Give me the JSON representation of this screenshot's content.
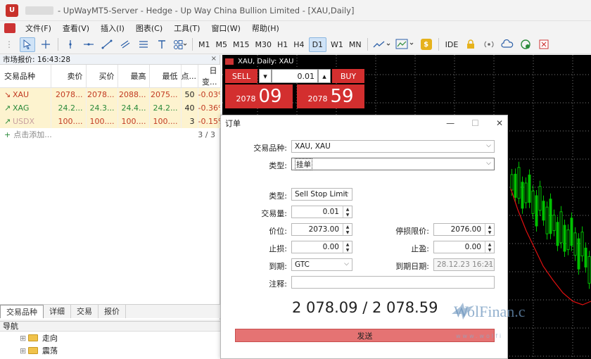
{
  "window": {
    "title": "- UpWayMT5-Server - Hedge - Up Way China Bullion Limited - [XAU,Daily]"
  },
  "menu": [
    "文件(F)",
    "查看(V)",
    "插入(I)",
    "图表(C)",
    "工具(T)",
    "窗口(W)",
    "帮助(H)"
  ],
  "toolbar": {
    "timeframes": [
      "M1",
      "M5",
      "M15",
      "M30",
      "H1",
      "H4",
      "D1",
      "W1",
      "MN"
    ],
    "active_timeframe": "D1",
    "ide_label": "IDE"
  },
  "market_watch": {
    "title": "市场报价: 16:43:28",
    "columns": [
      "交易品种",
      "卖价",
      "买价",
      "最高",
      "最低",
      "点...",
      "日变..."
    ],
    "rows": [
      {
        "symbol": "XAU",
        "arrow": "↘",
        "bid": "2078...",
        "ask": "2078...",
        "high": "2088...",
        "low": "2075...",
        "spread": "50",
        "change": "-0.03%"
      },
      {
        "symbol": "XAG",
        "arrow": "↗",
        "bid": "24.2...",
        "ask": "24.3...",
        "high": "24.4...",
        "low": "24.2...",
        "spread": "40",
        "change": "-0.36%"
      },
      {
        "symbol": "USDX",
        "arrow": "↗",
        "bid": "100....",
        "ask": "100....",
        "high": "100....",
        "low": "100....",
        "spread": "3",
        "change": "-0.15%"
      }
    ],
    "add_label": "点击添加...",
    "count": "3 / 3",
    "tabs": [
      "交易品种",
      "详细",
      "交易",
      "报价"
    ],
    "active_tab": "交易品种"
  },
  "navigator": {
    "title": "导航",
    "items": [
      "走向",
      "震荡"
    ]
  },
  "chart": {
    "header": "XAU, Daily: XAU",
    "sell_label": "SELL",
    "buy_label": "BUY",
    "volume": "0.01",
    "sell_small": "2078",
    "sell_big": "09",
    "buy_small": "2078",
    "buy_big": "59"
  },
  "order_dialog": {
    "title": "订单",
    "symbol_label": "交易品种:",
    "symbol_value": "XAU, XAU",
    "type_label": "类型:",
    "type_value": "挂单",
    "order_type_label": "类型:",
    "order_type_value": "Sell Stop Limit",
    "volume_label": "交易量:",
    "volume_value": "0.01",
    "price_label": "价位:",
    "price_value": "2073.00",
    "stop_limit_label": "停损限价:",
    "stop_limit_value": "2076.00",
    "sl_label": "止损:",
    "sl_value": "0.00",
    "tp_label": "止盈:",
    "tp_value": "0.00",
    "expiry_label": "到期:",
    "expiry_value": "GTC",
    "expiry_date_label": "到期日期:",
    "expiry_date_value": "28.12.23 16:21",
    "comment_label": "注释:",
    "bid_ask": "2 078.09 / 2 078.59",
    "send_label": "发送"
  },
  "watermark": {
    "text": "WolFinan.c",
    "sub": "www.wolfi"
  },
  "colors": {
    "sell_red": "#d32f2f",
    "down_red": "#c23b22",
    "up_green": "#2a8a3a",
    "candle_green": "#00c000",
    "ma_red": "#e01010"
  }
}
